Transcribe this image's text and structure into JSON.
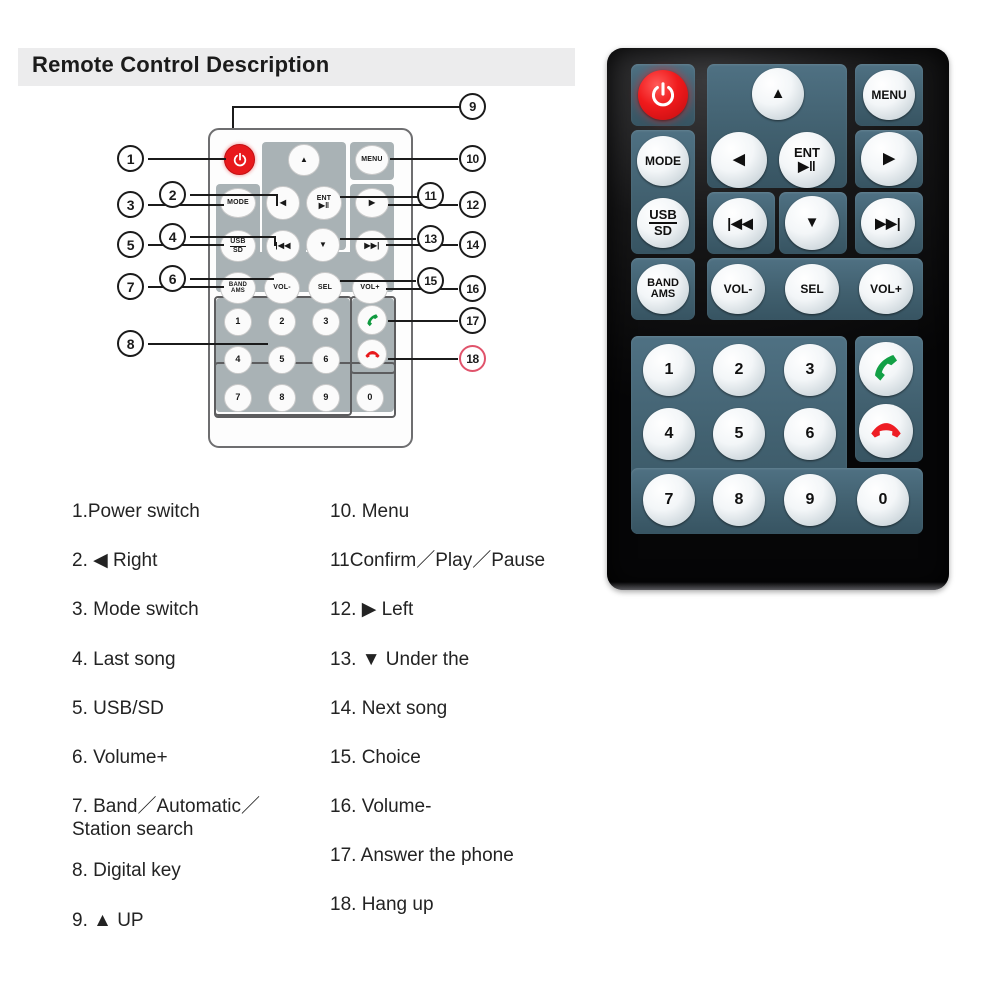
{
  "page": {
    "title": "Remote Control Description",
    "accent_red": "#e8191c",
    "accent_green": "#0f9a3f",
    "callout_highlight_color": "#e0536b",
    "title_band_color": "#ececed",
    "photo_body_color": "#111112",
    "photo_plate_color": "#41606f"
  },
  "diagram": {
    "name": "remote-control-schematic",
    "buttons": {
      "power": "power-icon",
      "menu": "MENU",
      "mode": "MODE",
      "usb": "USB",
      "sd": "SD",
      "band": "BAND",
      "ams": "AMS",
      "up": "▲",
      "down": "▼",
      "left_glyph": "◀",
      "right_glyph": "▶",
      "ent_top": "ENT",
      "ent_bottom": "▶‖",
      "prev": "|◀◀",
      "next": "▶▶|",
      "vol_down": "VOL-",
      "vol_up": "VOL+",
      "sel": "SEL",
      "answer": "answer-call-icon",
      "hangup": "hang-up-icon"
    },
    "keypad": [
      "1",
      "2",
      "3",
      "4",
      "5",
      "6",
      "7",
      "8",
      "9",
      "0"
    ],
    "callouts": [
      {
        "n": "1"
      },
      {
        "n": "2"
      },
      {
        "n": "3"
      },
      {
        "n": "4"
      },
      {
        "n": "5"
      },
      {
        "n": "6"
      },
      {
        "n": "7"
      },
      {
        "n": "8"
      },
      {
        "n": "9"
      },
      {
        "n": "10"
      },
      {
        "n": "11"
      },
      {
        "n": "12"
      },
      {
        "n": "13"
      },
      {
        "n": "14"
      },
      {
        "n": "15"
      },
      {
        "n": "16"
      },
      {
        "n": "17"
      },
      {
        "n": "18"
      }
    ]
  },
  "legend": {
    "left": [
      "1.Power switch",
      "2. ◀ Right",
      "3. Mode switch",
      "4. Last song",
      "5. USB/SD",
      "6. Volume+",
      "7. Band／Automatic／\n   Station search",
      "8. Digital key",
      "9. ▲ UP"
    ],
    "right": [
      "10. Menu",
      "11Confirm／Play／Pause",
      "12. ▶  Left",
      "13. ▼  Under the",
      "14. Next song",
      "15. Choice",
      "16. Volume-",
      "17. Answer the phone",
      "18. Hang up"
    ]
  },
  "photo": {
    "name": "remote-control-photo",
    "buttons": {
      "power": "power-icon",
      "menu": "MENU",
      "mode": "MODE",
      "usb": "USB",
      "sd": "SD",
      "band": "BAND",
      "ams": "AMS",
      "up": "▲",
      "down": "▼",
      "left_glyph": "◀",
      "right_glyph": "▶",
      "ent_top": "ENT",
      "ent_bottom": "▶‖",
      "prev": "|◀◀",
      "next": "▶▶|",
      "vol_down": "VOL-",
      "vol_up": "VOL+",
      "sel": "SEL",
      "answer": "answer-call-icon",
      "hangup": "hang-up-icon"
    },
    "keypad": [
      "1",
      "2",
      "3",
      "4",
      "5",
      "6",
      "7",
      "8",
      "9",
      "0"
    ]
  }
}
